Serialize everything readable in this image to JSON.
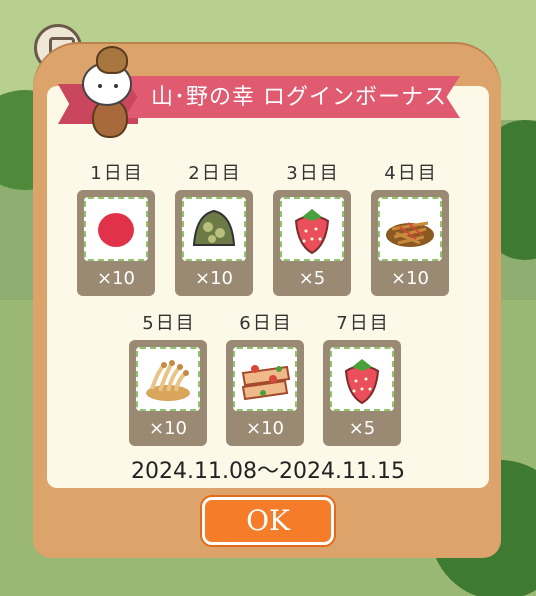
{
  "banner": {
    "title": "山･野の幸 ログインボーナス"
  },
  "days": [
    {
      "label": "1日目",
      "item": "red-fruit-icon",
      "qty": "×10"
    },
    {
      "label": "2日目",
      "item": "mushroom-rice-ball-icon",
      "qty": "×10"
    },
    {
      "label": "3日目",
      "item": "strawberry-icon",
      "qty": "×5"
    },
    {
      "label": "4日目",
      "item": "kinpira-icon",
      "qty": "×10"
    },
    {
      "label": "5日目",
      "item": "enoki-mushroom-icon",
      "qty": "×10"
    },
    {
      "label": "6日目",
      "item": "stir-fry-icon",
      "qty": "×10"
    },
    {
      "label": "7日目",
      "item": "strawberry-icon",
      "qty": "×5"
    }
  ],
  "date_range": "2024.11.08～2024.11.15",
  "ok_button": "OK",
  "colors": {
    "banner": "#e05a70",
    "frame": "#dca36b",
    "panel": "#fdf9e8",
    "button": "#f57d2a"
  }
}
